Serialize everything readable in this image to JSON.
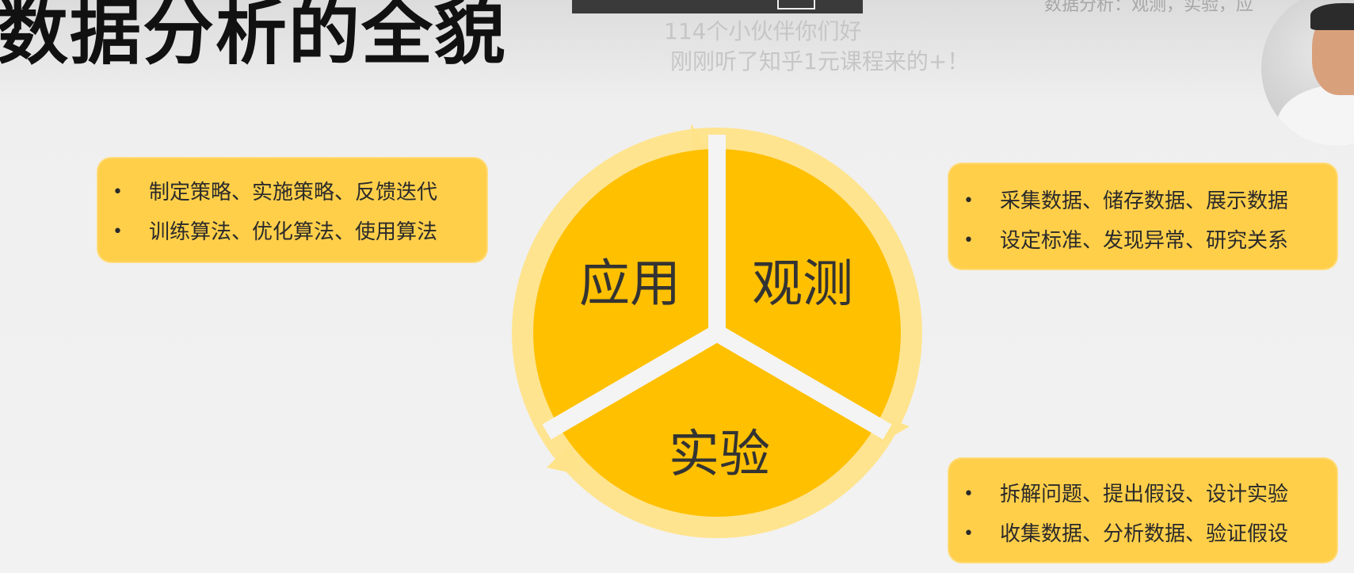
{
  "slide": {
    "title": "数据分析的全貌"
  },
  "overlay": {
    "top_right_text": "数据分析：观测，实验，应",
    "danmu": [
      "114个小伙伴你们好",
      "刚刚听了知乎1元课程来的+！"
    ]
  },
  "cycle": {
    "segments": [
      "应用",
      "观测",
      "实验"
    ],
    "colors": {
      "fill": "#ffc000",
      "ring": "#ffe38a",
      "text": "#333333"
    }
  },
  "boxes": {
    "application": [
      "制定策略、实施策略、反馈迭代",
      "训练算法、优化算法、使用算法"
    ],
    "observation": [
      "采集数据、储存数据、展示数据",
      "设定标准、发现异常、研究关系"
    ],
    "experiment": [
      "拆解问题、提出假设、设计实验",
      "收集数据、分析数据、验证假设"
    ]
  },
  "bullet_symbol": "•"
}
